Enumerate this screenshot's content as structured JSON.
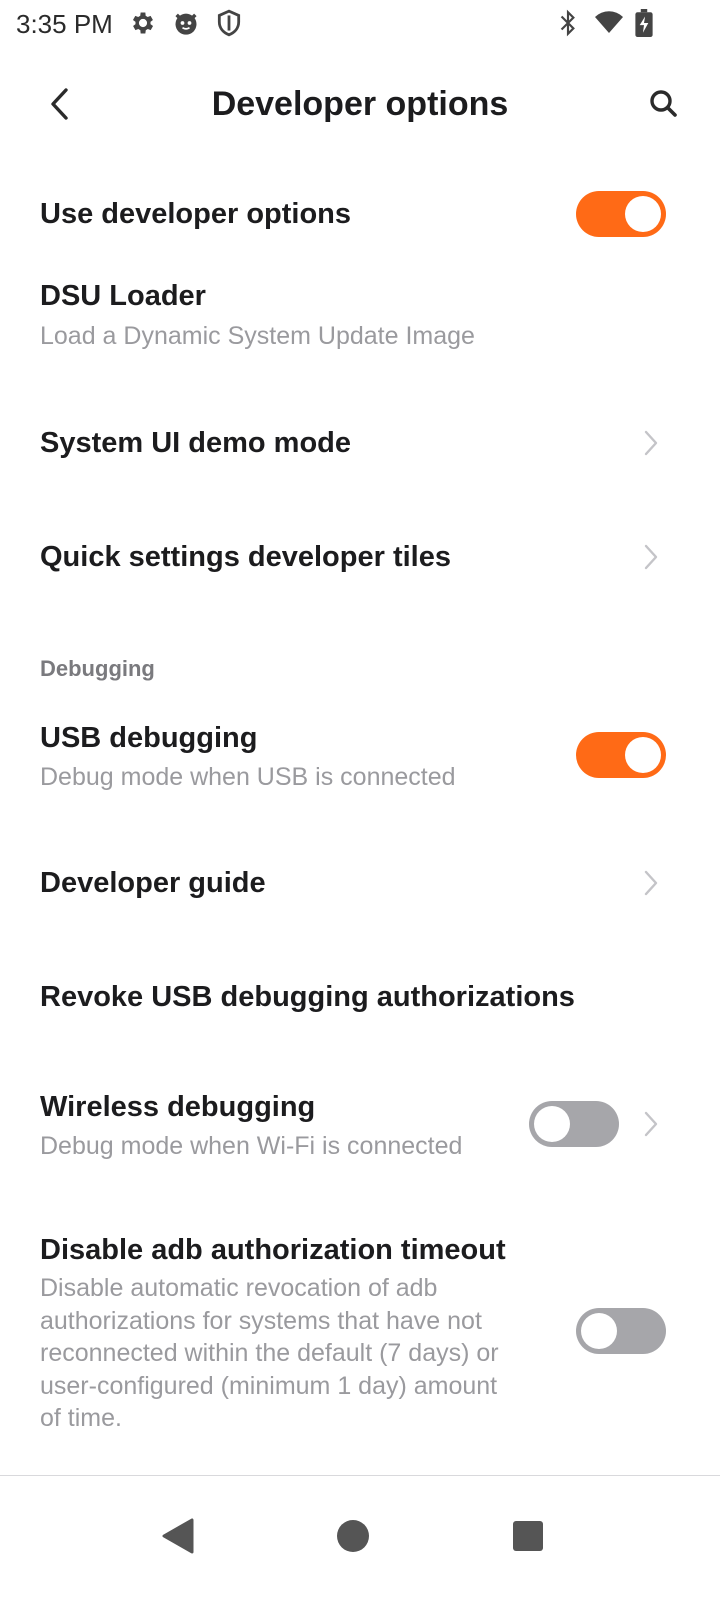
{
  "status_bar": {
    "time": "3:35 PM",
    "left_icons": [
      "gear-icon",
      "cat-face-icon",
      "shield-icon"
    ],
    "right_icons": [
      "bluetooth-icon",
      "wifi-icon",
      "battery-charging-icon"
    ]
  },
  "header": {
    "title": "Developer options",
    "back_icon": "chevron-left-icon",
    "search_icon": "search-icon"
  },
  "settings": {
    "use_developer_options": {
      "title": "Use developer options",
      "enabled": true
    },
    "dsu_loader": {
      "title": "DSU Loader",
      "subtitle": "Load a Dynamic System Update Image"
    },
    "system_ui_demo_mode": {
      "title": "System UI demo mode"
    },
    "quick_settings_tiles": {
      "title": "Quick settings developer tiles"
    },
    "debugging_section": {
      "header": "Debugging"
    },
    "usb_debugging": {
      "title": "USB debugging",
      "subtitle": "Debug mode when USB is connected",
      "enabled": true
    },
    "developer_guide": {
      "title": "Developer guide"
    },
    "revoke_usb": {
      "title": "Revoke USB debugging authorizations"
    },
    "wireless_debugging": {
      "title": "Wireless debugging",
      "subtitle": "Debug mode when Wi-Fi is connected",
      "enabled": false
    },
    "disable_adb_timeout": {
      "title": "Disable adb authorization timeout",
      "subtitle_lines": [
        "Disable automatic revocation of adb",
        "authorizations for systems that have not",
        "reconnected within the default (7 days) or",
        "user-configured (minimum 1 day) amount",
        "of time."
      ],
      "enabled": false
    }
  },
  "nav_bar": {
    "back_icon": "triangle-back-icon",
    "home_icon": "circle-home-icon",
    "recents_icon": "square-recents-icon"
  },
  "colors": {
    "accent": "#ff6a16",
    "toggle_off": "#a6a6aa",
    "title_text": "#1c1c1e",
    "subtitle_text": "#9a9a9e",
    "section_text": "#7a7a7e"
  }
}
